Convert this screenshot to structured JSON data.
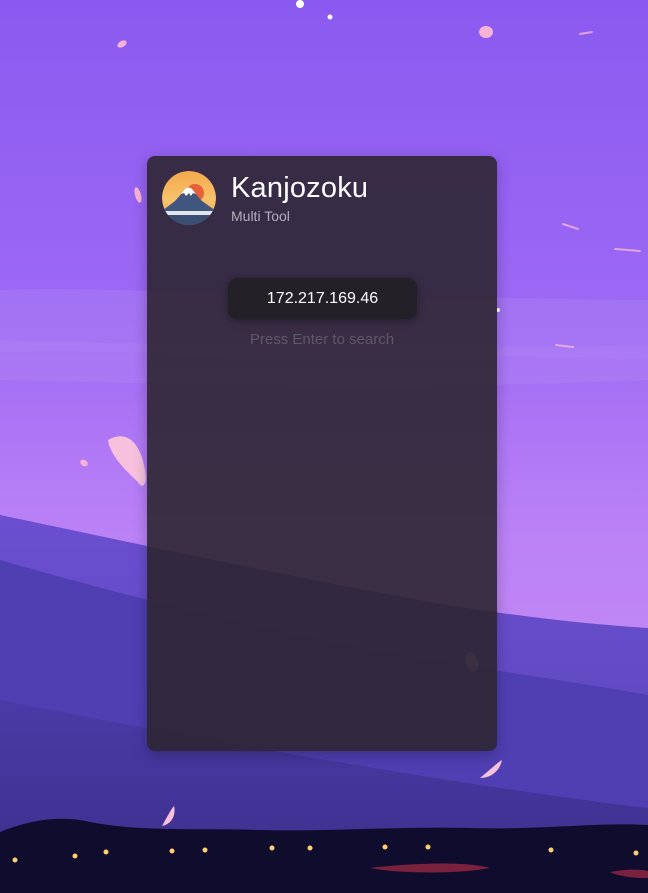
{
  "app": {
    "title": "Kanjozoku",
    "subtitle": "Multi Tool",
    "logo_icon": "mount-fuji-sunset-logo-icon"
  },
  "search": {
    "value": "172.217.169.46",
    "hint": "Press Enter to search"
  },
  "colors": {
    "panel": "#2c2632",
    "input": "#232027",
    "sky_top": "#8b5cf0",
    "sky_horizon": "#c48af4",
    "hills": "#3c3288",
    "ground": "#0f0c2a",
    "petal": "#f7b6d8"
  }
}
